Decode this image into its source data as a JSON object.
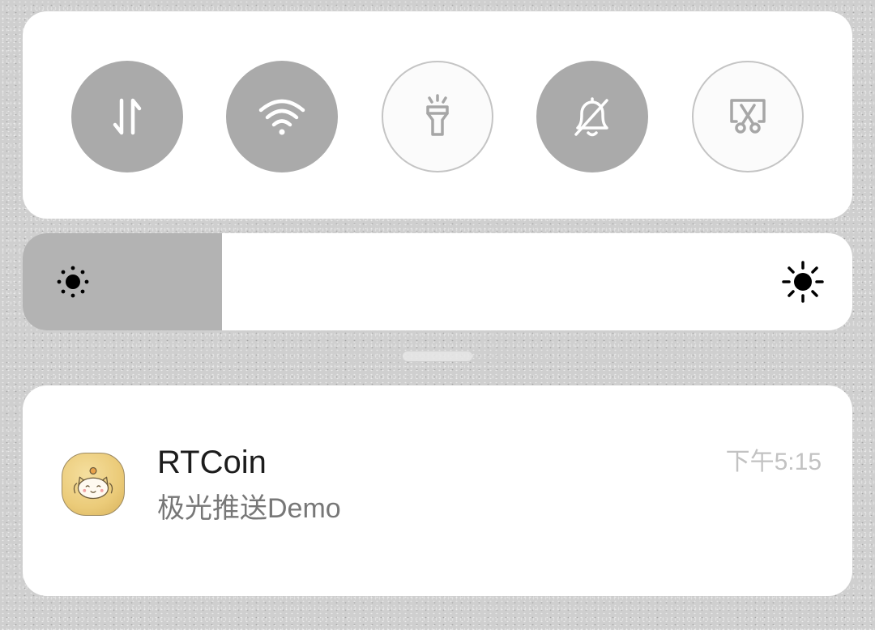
{
  "quick_toggles": [
    {
      "icon": "mobile-data-icon",
      "state": "on"
    },
    {
      "icon": "wifi-icon",
      "state": "on"
    },
    {
      "icon": "flashlight-icon",
      "state": "off"
    },
    {
      "icon": "silent-mode-icon",
      "state": "on"
    },
    {
      "icon": "screenshot-icon",
      "state": "off"
    }
  ],
  "brightness": {
    "level": 0.24,
    "min_icon": "sun-small-icon",
    "max_icon": "sun-large-icon"
  },
  "notification": {
    "app_icon": "lucky-cat-app-icon",
    "title": "RTCoin",
    "body": "极光推送Demo",
    "time": "下午5:15"
  },
  "colors": {
    "toggle_on": "#aaaaaa",
    "toggle_off": "#fbfbfb",
    "brightness_fill": "#b3b3b3",
    "card": "#ffffff",
    "time_text": "#c2c2c2"
  }
}
